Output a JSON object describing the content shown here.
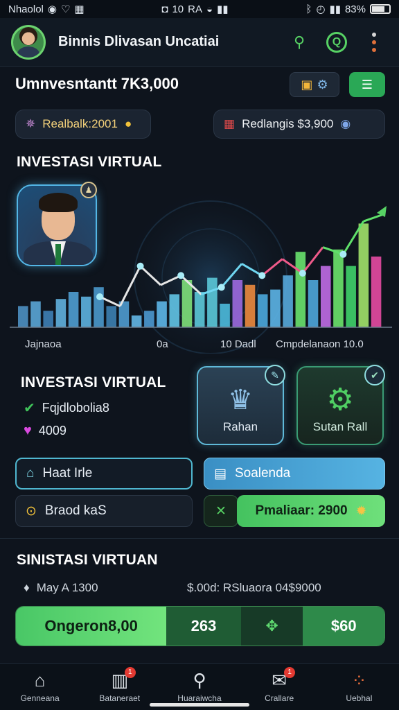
{
  "status_bar": {
    "left_text": "Nhaolol",
    "center_text": "10",
    "center_text_2": "RA",
    "battery_text": "83%"
  },
  "header": {
    "title": "Binnis Dlivasan Uncatiai"
  },
  "investment": {
    "title": "Umnvesntantt 7K3,000"
  },
  "pills": {
    "left_label": "Realbalk:2001",
    "right_label": "Redlangis $3,900"
  },
  "chart_section": {
    "title": "INVESTASI VIRTUAL",
    "x_labels": [
      "Jajnaoa",
      "0a",
      "10 Dadl",
      "Cmpdelanaon 10.0"
    ]
  },
  "chart_data": {
    "type": "bar",
    "bar_values": [
      18,
      22,
      14,
      24,
      30,
      26,
      34,
      18,
      22,
      10,
      14,
      22,
      28,
      40,
      30,
      42,
      20,
      40,
      36,
      28,
      32,
      44,
      64,
      40,
      52,
      66,
      52,
      88,
      60
    ],
    "bar_colors": [
      "#4d8fc2",
      "#5aa5d6",
      "#3e7fb6",
      "#61b0de",
      "#4f9dd1",
      "#5db1e0",
      "#4a98cc",
      "#3c7fb2",
      "#4f9bd0",
      "#63b6e6",
      "#4b98cf",
      "#5db6e8",
      "#62c4e6",
      "#7fe07a",
      "#5cc8d8",
      "#5bc8d8",
      "#4cbadb",
      "#9d6ae0",
      "#ec8a3e",
      "#4ba8dd",
      "#5cb4e6",
      "#57a8db",
      "#69e26e",
      "#4ea6db",
      "#c06be6",
      "#6be36b",
      "#3fd06a",
      "#a2e26a",
      "#e64aa3"
    ],
    "line_values": [
      20,
      12,
      46,
      30,
      38,
      22,
      28,
      48,
      38,
      52,
      40,
      62,
      56,
      84,
      90
    ],
    "ylim": [
      0,
      100
    ]
  },
  "info_section": {
    "title": "INVESTASI VIRTUAL",
    "items": [
      {
        "label": "Fqjdlobolia8"
      },
      {
        "label": "4009"
      }
    ]
  },
  "cards": [
    {
      "label": "Rahan"
    },
    {
      "label": "Sutan Rall"
    }
  ],
  "buttons": {
    "hast": "Haat Irle",
    "soalenda": "Soalenda",
    "braod": "Braod kaS",
    "pmaliaar": "Pmaliaar: 2900"
  },
  "summary_section": {
    "title": "SINISTASI VIRTUAN",
    "left_text": "May A 1300",
    "right_text": "$.00d: RSluaora 04$9000",
    "bar": {
      "main": "Ongeron8,00",
      "value_1": "263",
      "value_2": " ",
      "value_3": "$60"
    }
  },
  "nav": {
    "items": [
      {
        "label": "Genneana"
      },
      {
        "label": "Bataneraet",
        "badge": "1"
      },
      {
        "label": "Huaraiwcha"
      },
      {
        "label": "Crallare",
        "badge": "1"
      },
      {
        "label": "Uebhal"
      }
    ]
  }
}
